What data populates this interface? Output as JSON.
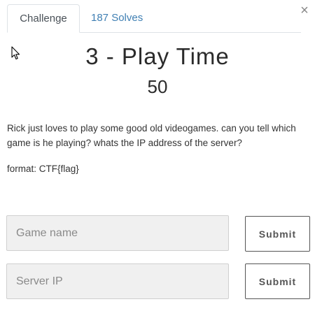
{
  "tabs": [
    {
      "label": "Challenge",
      "active": true
    },
    {
      "label": "187 Solves",
      "active": false
    }
  ],
  "close_label": "×",
  "challenge": {
    "title": "3 - Play Time",
    "value": "50",
    "description": "Rick just loves to play some good old videogames. can you tell which game is he playing? whats the IP address of the server?",
    "format": "format: CTF{flag}"
  },
  "fields": {
    "game_name": {
      "placeholder": "Game name",
      "value": ""
    },
    "server_ip": {
      "placeholder": "Server IP",
      "value": ""
    }
  },
  "buttons": {
    "submit_1": "Submit",
    "submit_2": "Submit"
  },
  "icons": {
    "cursor": "mouse-pointer-icon",
    "close": "close-icon"
  },
  "colors": {
    "link": "#3f7fb3",
    "input_bg": "#f0f0f0",
    "text": "#2b2b2b"
  }
}
